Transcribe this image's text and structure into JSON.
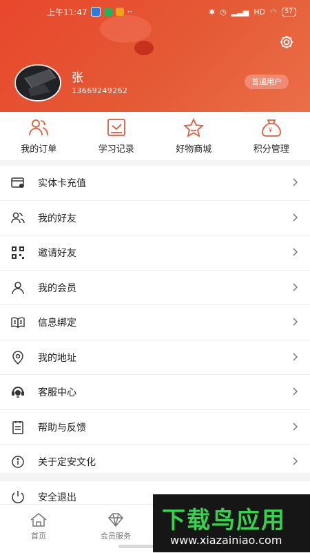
{
  "status_bar": {
    "time": "上午11:47",
    "battery": "57",
    "dots": "··",
    "signal": "HD"
  },
  "profile": {
    "name": "张",
    "phone": "13669249262",
    "badge": "普通用户"
  },
  "quick_actions": [
    {
      "label": "我的订单",
      "icon": "people-icon"
    },
    {
      "label": "学习记录",
      "icon": "study-record-icon"
    },
    {
      "label": "好物商城",
      "icon": "star-icon"
    },
    {
      "label": "积分管理",
      "icon": "money-bag-icon"
    }
  ],
  "menu_items": [
    {
      "label": "实体卡充值",
      "icon": "card-icon"
    },
    {
      "label": "我的好友",
      "icon": "friends-icon"
    },
    {
      "label": "邀请好友",
      "icon": "qr-code-icon"
    },
    {
      "label": "我的会员",
      "icon": "user-icon"
    },
    {
      "label": "信息绑定",
      "icon": "book-icon"
    },
    {
      "label": "我的地址",
      "icon": "location-icon"
    },
    {
      "label": "客服中心",
      "icon": "headset-icon"
    },
    {
      "label": "帮助与反馈",
      "icon": "feedback-icon"
    },
    {
      "label": "关于定安文化",
      "icon": "info-icon"
    }
  ],
  "logout": {
    "label": "安全退出",
    "icon": "power-icon"
  },
  "bottom_nav": [
    {
      "label": "首页",
      "icon": "home-icon"
    },
    {
      "label": "会员服务",
      "icon": "diamond-icon"
    }
  ],
  "watermark": {
    "main": "下载鸟应用",
    "url": "www.xiazainiao.com"
  },
  "colors": {
    "header": "#e8472c",
    "accent": "#e25a3a",
    "badge_bg": "#f08a73",
    "text": "#222222"
  }
}
